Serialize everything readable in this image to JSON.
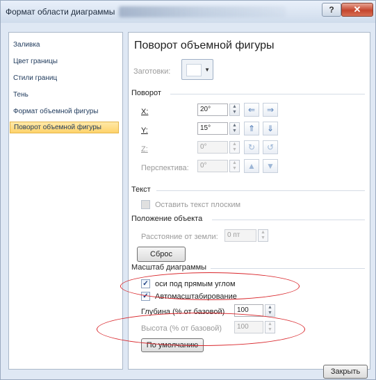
{
  "window": {
    "title": "Формат области диаграммы",
    "help_label": "?",
    "close_label": "✕"
  },
  "nav": {
    "items": [
      "Заливка",
      "Цвет границы",
      "Стили границ",
      "Тень",
      "Формат объемной фигуры",
      "Поворот объемной фигуры"
    ],
    "selected_index": 5
  },
  "panel": {
    "heading": "Поворот объемной фигуры",
    "presets_label": "Заготовки:",
    "rotation": {
      "title": "Поворот",
      "x_label": "X:",
      "x_value": "20°",
      "y_label": "Y:",
      "y_value": "15°",
      "z_label": "Z:",
      "z_value": "0°",
      "perspective_label": "Перспектива:",
      "perspective_value": "0°"
    },
    "text": {
      "title": "Текст",
      "keep_flat_label": "Оставить текст плоским"
    },
    "position": {
      "title": "Положение объекта",
      "distance_label": "Расстояние от земли:",
      "distance_value": "0 пт",
      "reset_label": "Сброс"
    },
    "chart_scale": {
      "title": "Масштаб диаграммы",
      "right_angle_axes_label": "оси под прямым углом",
      "autoscale_label": "Автомасштабирование",
      "depth_label": "Глубина (% от базовой)",
      "depth_value": "100",
      "height_label": "Высота (% от базовой)",
      "height_value": "100",
      "default_label": "По умолчанию"
    }
  },
  "footer": {
    "close_label": "Закрыть"
  },
  "colors": {
    "annotation": "#d9252a",
    "selection": "#ffd36b"
  }
}
